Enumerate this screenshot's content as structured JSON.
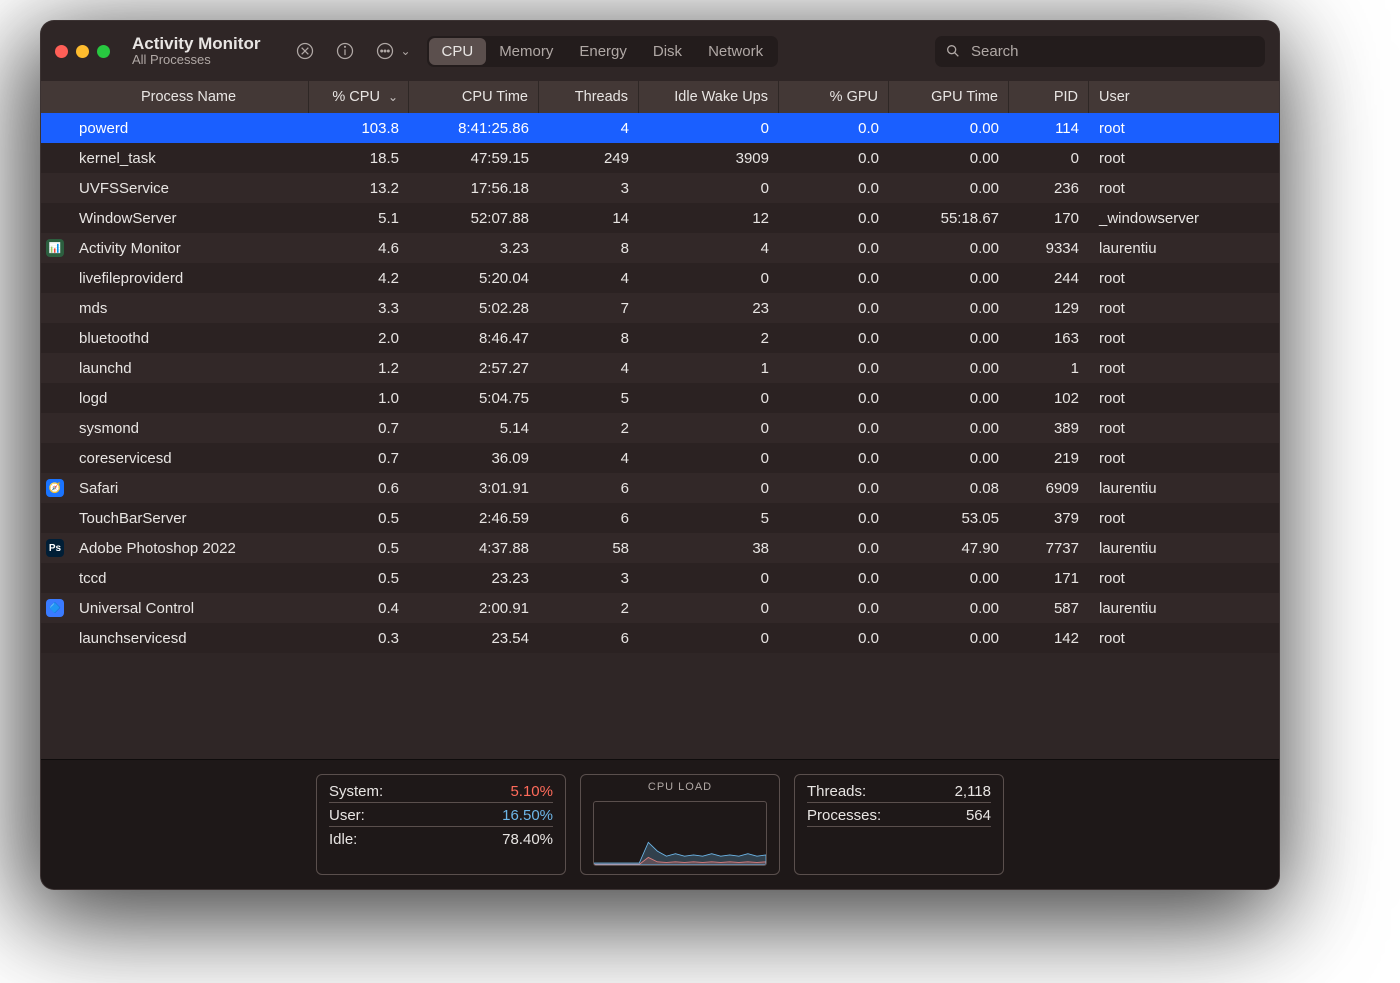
{
  "window": {
    "title": "Activity Monitor",
    "subtitle": "All Processes"
  },
  "tabs": [
    "CPU",
    "Memory",
    "Energy",
    "Disk",
    "Network"
  ],
  "active_tab": 0,
  "search": {
    "placeholder": "Search",
    "value": ""
  },
  "columns": [
    {
      "key": "name",
      "label": "Process Name",
      "align": "l",
      "sort": false
    },
    {
      "key": "cpu",
      "label": "% CPU",
      "align": "r",
      "sort": true,
      "dir": "desc"
    },
    {
      "key": "cputime",
      "label": "CPU Time",
      "align": "r"
    },
    {
      "key": "threads",
      "label": "Threads",
      "align": "r"
    },
    {
      "key": "wake",
      "label": "Idle Wake Ups",
      "align": "r"
    },
    {
      "key": "gpu",
      "label": "% GPU",
      "align": "r"
    },
    {
      "key": "gputime",
      "label": "GPU Time",
      "align": "r"
    },
    {
      "key": "pid",
      "label": "PID",
      "align": "r"
    },
    {
      "key": "user",
      "label": "User",
      "align": "l"
    }
  ],
  "rows": [
    {
      "icon": null,
      "name": "powerd",
      "cpu": "103.8",
      "cputime": "8:41:25.86",
      "threads": "4",
      "wake": "0",
      "gpu": "0.0",
      "gputime": "0.00",
      "pid": "114",
      "user": "root",
      "selected": true
    },
    {
      "icon": null,
      "name": "kernel_task",
      "cpu": "18.5",
      "cputime": "47:59.15",
      "threads": "249",
      "wake": "3909",
      "gpu": "0.0",
      "gputime": "0.00",
      "pid": "0",
      "user": "root"
    },
    {
      "icon": null,
      "name": "UVFSService",
      "cpu": "13.2",
      "cputime": "17:56.18",
      "threads": "3",
      "wake": "0",
      "gpu": "0.0",
      "gputime": "0.00",
      "pid": "236",
      "user": "root"
    },
    {
      "icon": null,
      "name": "WindowServer",
      "cpu": "5.1",
      "cputime": "52:07.88",
      "threads": "14",
      "wake": "12",
      "gpu": "0.0",
      "gputime": "55:18.67",
      "pid": "170",
      "user": "_windowserver"
    },
    {
      "icon": {
        "bg": "#2c5f3f",
        "text": "📊"
      },
      "name": "Activity Monitor",
      "cpu": "4.6",
      "cputime": "3.23",
      "threads": "8",
      "wake": "4",
      "gpu": "0.0",
      "gputime": "0.00",
      "pid": "9334",
      "user": "laurentiu"
    },
    {
      "icon": null,
      "name": "livefileproviderd",
      "cpu": "4.2",
      "cputime": "5:20.04",
      "threads": "4",
      "wake": "0",
      "gpu": "0.0",
      "gputime": "0.00",
      "pid": "244",
      "user": "root"
    },
    {
      "icon": null,
      "name": "mds",
      "cpu": "3.3",
      "cputime": "5:02.28",
      "threads": "7",
      "wake": "23",
      "gpu": "0.0",
      "gputime": "0.00",
      "pid": "129",
      "user": "root"
    },
    {
      "icon": null,
      "name": "bluetoothd",
      "cpu": "2.0",
      "cputime": "8:46.47",
      "threads": "8",
      "wake": "2",
      "gpu": "0.0",
      "gputime": "0.00",
      "pid": "163",
      "user": "root"
    },
    {
      "icon": null,
      "name": "launchd",
      "cpu": "1.2",
      "cputime": "2:57.27",
      "threads": "4",
      "wake": "1",
      "gpu": "0.0",
      "gputime": "0.00",
      "pid": "1",
      "user": "root"
    },
    {
      "icon": null,
      "name": "logd",
      "cpu": "1.0",
      "cputime": "5:04.75",
      "threads": "5",
      "wake": "0",
      "gpu": "0.0",
      "gputime": "0.00",
      "pid": "102",
      "user": "root"
    },
    {
      "icon": null,
      "name": "sysmond",
      "cpu": "0.7",
      "cputime": "5.14",
      "threads": "2",
      "wake": "0",
      "gpu": "0.0",
      "gputime": "0.00",
      "pid": "389",
      "user": "root"
    },
    {
      "icon": null,
      "name": "coreservicesd",
      "cpu": "0.7",
      "cputime": "36.09",
      "threads": "4",
      "wake": "0",
      "gpu": "0.0",
      "gputime": "0.00",
      "pid": "219",
      "user": "root"
    },
    {
      "icon": {
        "bg": "#1a74ff",
        "text": "🧭"
      },
      "name": "Safari",
      "cpu": "0.6",
      "cputime": "3:01.91",
      "threads": "6",
      "wake": "0",
      "gpu": "0.0",
      "gputime": "0.08",
      "pid": "6909",
      "user": "laurentiu"
    },
    {
      "icon": null,
      "name": "TouchBarServer",
      "cpu": "0.5",
      "cputime": "2:46.59",
      "threads": "6",
      "wake": "5",
      "gpu": "0.0",
      "gputime": "53.05",
      "pid": "379",
      "user": "root"
    },
    {
      "icon": {
        "bg": "#001e36",
        "text": "Ps"
      },
      "name": "Adobe Photoshop 2022",
      "cpu": "0.5",
      "cputime": "4:37.88",
      "threads": "58",
      "wake": "38",
      "gpu": "0.0",
      "gputime": "47.90",
      "pid": "7737",
      "user": "laurentiu"
    },
    {
      "icon": null,
      "name": "tccd",
      "cpu": "0.5",
      "cputime": "23.23",
      "threads": "3",
      "wake": "0",
      "gpu": "0.0",
      "gputime": "0.00",
      "pid": "171",
      "user": "root"
    },
    {
      "icon": {
        "bg": "#3a7bff",
        "text": "🔷"
      },
      "name": "Universal Control",
      "cpu": "0.4",
      "cputime": "2:00.91",
      "threads": "2",
      "wake": "0",
      "gpu": "0.0",
      "gputime": "0.00",
      "pid": "587",
      "user": "laurentiu"
    },
    {
      "icon": null,
      "name": "launchservicesd",
      "cpu": "0.3",
      "cputime": "23.54",
      "threads": "6",
      "wake": "0",
      "gpu": "0.0",
      "gputime": "0.00",
      "pid": "142",
      "user": "root"
    }
  ],
  "summary": {
    "system_label": "System:",
    "system_value": "5.10%",
    "user_label": "User:",
    "user_value": "16.50%",
    "idle_label": "Idle:",
    "idle_value": "78.40%",
    "chart_title": "CPU LOAD",
    "threads_label": "Threads:",
    "threads_value": "2,118",
    "processes_label": "Processes:",
    "processes_value": "564"
  },
  "chart_data": {
    "type": "area",
    "series": [
      {
        "name": "user",
        "color": "#6db6e8",
        "values": [
          3,
          3,
          3,
          3,
          3,
          3,
          36,
          22,
          14,
          18,
          14,
          16,
          14,
          18,
          14,
          16,
          14,
          18,
          14,
          16
        ]
      },
      {
        "name": "system",
        "color": "#ff6b5b",
        "values": [
          1,
          1,
          1,
          1,
          1,
          1,
          12,
          5,
          4,
          5,
          4,
          5,
          4,
          5,
          4,
          5,
          4,
          5,
          4,
          5
        ]
      }
    ],
    "ymax": 100
  }
}
